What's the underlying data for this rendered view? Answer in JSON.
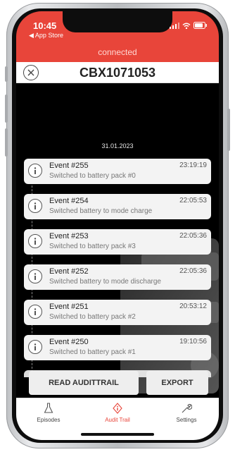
{
  "status": {
    "time": "10:45",
    "back_app": "◀ App Store"
  },
  "connection": {
    "text": "connected"
  },
  "header": {
    "title": "CBX1071053"
  },
  "audit": {
    "date": "31.01.2023",
    "events": [
      {
        "name": "Event #255",
        "time": "23:19:19",
        "desc": "Switched to battery pack #0"
      },
      {
        "name": "Event #254",
        "time": "22:05:53",
        "desc": "Switched battery to mode charge"
      },
      {
        "name": "Event #253",
        "time": "22:05:36",
        "desc": "Switched to battery pack #3"
      },
      {
        "name": "Event #252",
        "time": "22:05:36",
        "desc": "Switched battery to mode discharge"
      },
      {
        "name": "Event #251",
        "time": "20:53:12",
        "desc": "Switched to battery pack #2"
      },
      {
        "name": "Event #250",
        "time": "19:10:56",
        "desc": "Switched to battery pack #1"
      }
    ]
  },
  "actions": {
    "read": "READ AUDITTRAIL",
    "export": "EXPORT"
  },
  "tabs": [
    {
      "label": "Episodes",
      "icon": "flask-icon",
      "active": false
    },
    {
      "label": "Audit Trail",
      "icon": "audit-trail-icon",
      "active": true
    },
    {
      "label": "Settings",
      "icon": "wrench-icon",
      "active": false
    }
  ],
  "colors": {
    "accent": "#e8453a",
    "background": "#000000",
    "card": "#f3f3f3"
  }
}
